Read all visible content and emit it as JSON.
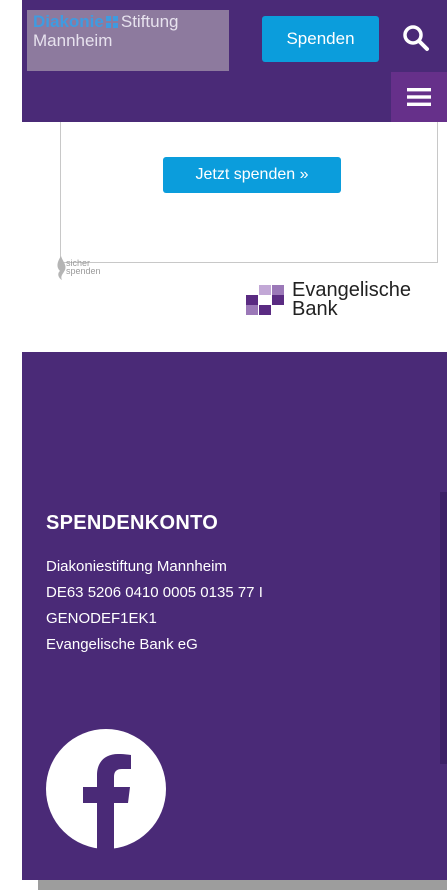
{
  "header": {
    "logo": {
      "brand": "Diakonie",
      "brand_suffix": "Stiftung",
      "city": "Mannheim"
    },
    "donate_label": "Spenden",
    "search_icon": "search-icon",
    "menu_icon": "hamburger-menu-icon"
  },
  "widget": {
    "spend_now_label": "Jetzt spenden »",
    "sicher_line1": "sicher",
    "sicher_line2": "spenden"
  },
  "partner": {
    "line1": "Evangelische",
    "line2": "Bank"
  },
  "footer": {
    "title": "SPENDENKONTO",
    "lines": [
      "Diakoniestiftung Mannheim",
      "DE63 5206 0410 0005 0135 77 I",
      "GENODEF1EK1",
      "Evangelische Bank eG"
    ],
    "social_icon": "facebook-icon"
  },
  "colors": {
    "purple": "#4a2a77",
    "menu_purple": "#66308a",
    "blue": "#0b9ddc"
  }
}
